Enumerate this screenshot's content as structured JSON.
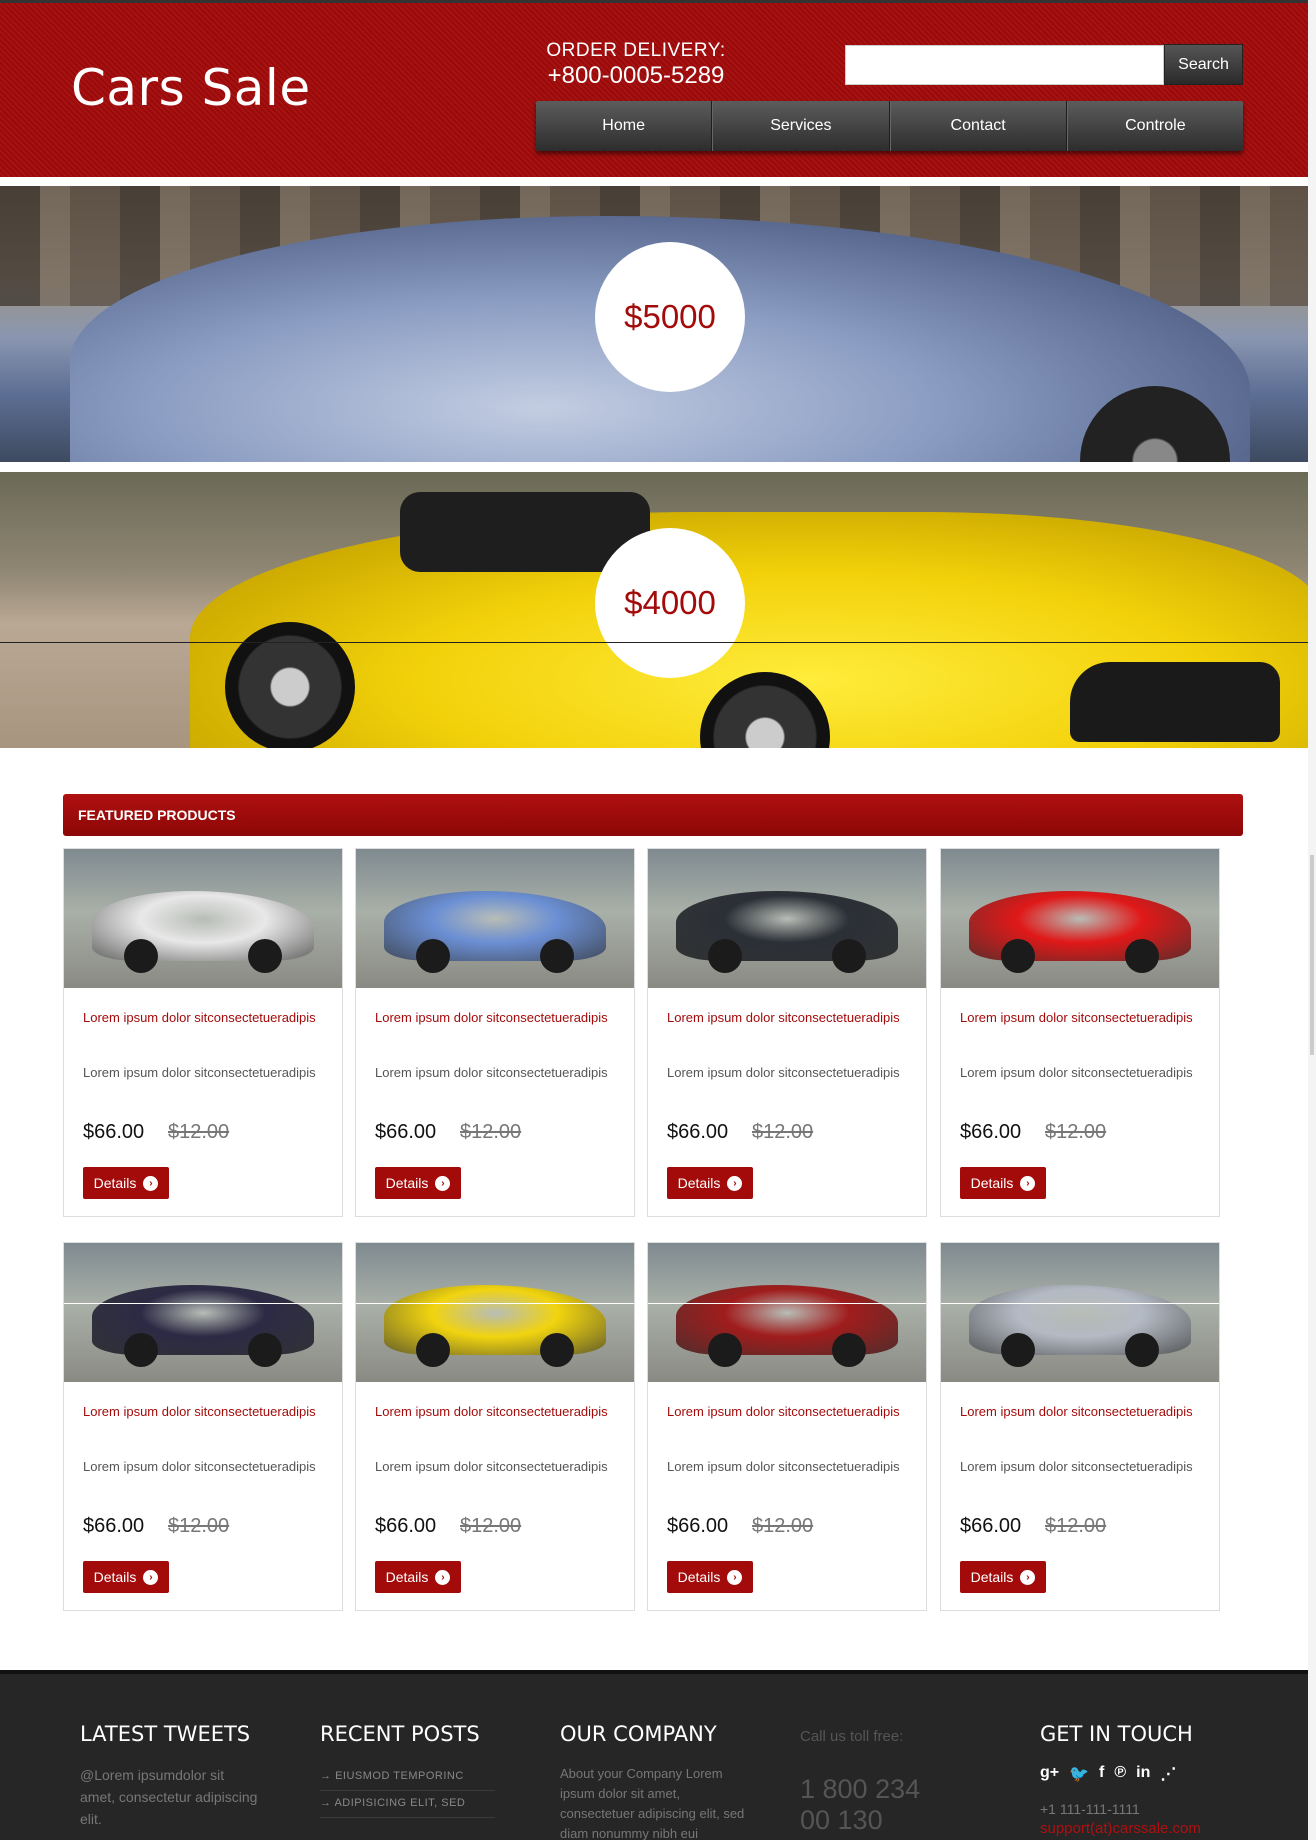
{
  "header": {
    "logo": "Cars Sale",
    "order_label": "ORDER DELIVERY:",
    "order_phone": "+800-0005-5289",
    "search_placeholder": "",
    "search_button": "Search",
    "nav": [
      "Home",
      "Services",
      "Contact",
      "Controle"
    ]
  },
  "banners": [
    {
      "price": "$5000"
    },
    {
      "price": "$4000"
    }
  ],
  "featured": {
    "heading": "FEATURED PRODUCTS",
    "products": [
      {
        "title": "Lorem ipsum dolor sitconsectetueradipis",
        "desc": "Lorem ipsum dolor sitconsectetueradipis",
        "price": "$66.00",
        "old_price": "$12.00",
        "button": "Details",
        "color": "#e8e8e8"
      },
      {
        "title": "Lorem ipsum dolor sitconsectetueradipis",
        "desc": "Lorem ipsum dolor sitconsectetueradipis",
        "price": "$66.00",
        "old_price": "$12.00",
        "button": "Details",
        "color": "#6b8fd4"
      },
      {
        "title": "Lorem ipsum dolor sitconsectetueradipis",
        "desc": "Lorem ipsum dolor sitconsectetueradipis",
        "price": "$66.00",
        "old_price": "$12.00",
        "button": "Details",
        "color": "#2b2f36"
      },
      {
        "title": "Lorem ipsum dolor sitconsectetueradipis",
        "desc": "Lorem ipsum dolor sitconsectetueradipis",
        "price": "$66.00",
        "old_price": "$12.00",
        "button": "Details",
        "color": "#e01818"
      },
      {
        "title": "Lorem ipsum dolor sitconsectetueradipis",
        "desc": "Lorem ipsum dolor sitconsectetueradipis",
        "price": "$66.00",
        "old_price": "$12.00",
        "button": "Details",
        "color": "#2c2a44"
      },
      {
        "title": "Lorem ipsum dolor sitconsectetueradipis",
        "desc": "Lorem ipsum dolor sitconsectetueradipis",
        "price": "$66.00",
        "old_price": "$12.00",
        "button": "Details",
        "color": "#f1d40f"
      },
      {
        "title": "Lorem ipsum dolor sitconsectetueradipis",
        "desc": "Lorem ipsum dolor sitconsectetueradipis",
        "price": "$66.00",
        "old_price": "$12.00",
        "button": "Details",
        "color": "#a01c1c"
      },
      {
        "title": "Lorem ipsum dolor sitconsectetueradipis",
        "desc": "Lorem ipsum dolor sitconsectetueradipis",
        "price": "$66.00",
        "old_price": "$12.00",
        "button": "Details",
        "color": "#b4bac4"
      }
    ]
  },
  "footer": {
    "tweets_heading": "LATEST TWEETS",
    "tweets_text": "@Lorem ipsumdolor sit amet, consectetur adipiscing elit.",
    "posts_heading": "RECENT POSTS",
    "posts": [
      "EIUSMOD TEMPORINC",
      "ADIPISICING ELIT, SED"
    ],
    "company_heading": "OUR COMPANY",
    "company_text": "About your Company Lorem ipsum dolor sit amet, consectetuer adipiscing elit, sed diam nonummy nibh eui",
    "call_label": "Call us toll free:",
    "call_number": "1 800 234",
    "call_number_2": "00 130",
    "touch_heading": "GET IN TOUCH",
    "social_icons": [
      "g+",
      "twitter",
      "f",
      "pinterest",
      "in",
      "rss"
    ],
    "touch_phone": "+1 111-111-1111",
    "touch_email": "support(at)carssale.com"
  }
}
